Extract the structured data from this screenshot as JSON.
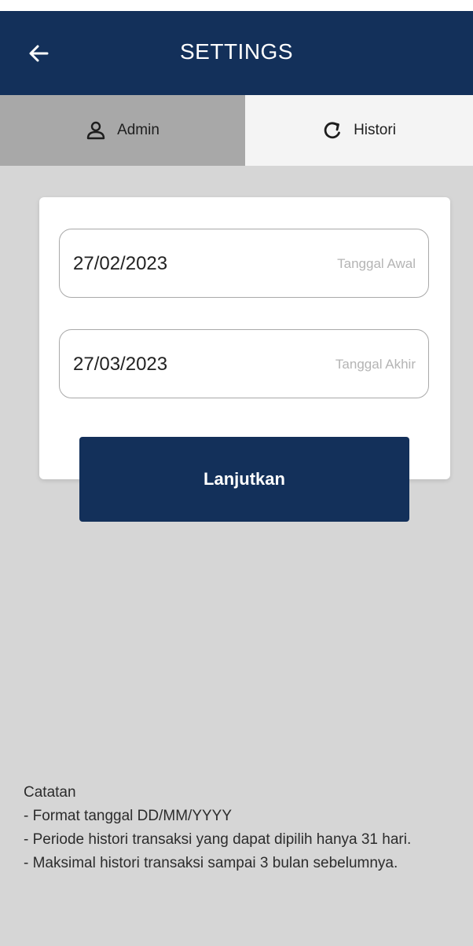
{
  "header": {
    "title": "SETTINGS",
    "back_icon": "arrow-left-icon",
    "background": "#13305a"
  },
  "tabs": [
    {
      "label": "Admin",
      "icon": "user-icon",
      "active": false
    },
    {
      "label": "Histori",
      "icon": "refresh-icon",
      "active": true
    }
  ],
  "form": {
    "start_date": {
      "value": "27/02/2023",
      "label": "Tanggal Awal"
    },
    "end_date": {
      "value": "27/03/2023",
      "label": "Tanggal Akhir"
    },
    "submit_label": "Lanjutkan"
  },
  "notes": {
    "heading": "Catatan",
    "lines": [
      "- Format tanggal DD/MM/YYYY",
      "- Periode histori transaksi yang dapat dipilih hanya 31 hari.",
      "- Maksimal histori transaksi sampai 3 bulan sebelumnya."
    ]
  }
}
